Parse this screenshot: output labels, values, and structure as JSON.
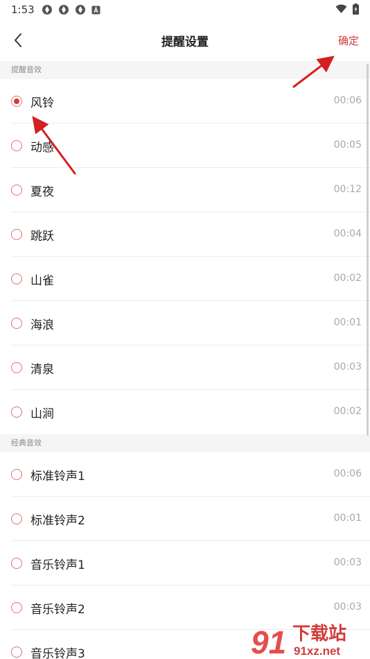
{
  "status_bar": {
    "time": "1:53",
    "left_icons": [
      "app-icon-1",
      "app-icon-2",
      "app-icon-3",
      "notification-a-icon"
    ],
    "right_icons": [
      "wifi-icon",
      "battery-icon"
    ]
  },
  "nav": {
    "title": "提醒设置",
    "confirm_label": "确定",
    "back_icon": "chevron-left-icon"
  },
  "colors": {
    "accent": "#d23b3b",
    "arrow": "#d42020",
    "section_bg": "#f5f5f5"
  },
  "sections": [
    {
      "title": "提醒音效",
      "items": [
        {
          "label": "风铃",
          "duration": "00:06",
          "selected": true
        },
        {
          "label": "动感",
          "duration": "00:05",
          "selected": false
        },
        {
          "label": "夏夜",
          "duration": "00:12",
          "selected": false
        },
        {
          "label": "跳跃",
          "duration": "00:04",
          "selected": false
        },
        {
          "label": "山雀",
          "duration": "00:02",
          "selected": false
        },
        {
          "label": "海浪",
          "duration": "00:01",
          "selected": false
        },
        {
          "label": "清泉",
          "duration": "00:03",
          "selected": false
        },
        {
          "label": "山涧",
          "duration": "00:02",
          "selected": false
        }
      ]
    },
    {
      "title": "经典音效",
      "items": [
        {
          "label": "标准铃声1",
          "duration": "00:06",
          "selected": false
        },
        {
          "label": "标准铃声2",
          "duration": "00:01",
          "selected": false
        },
        {
          "label": "音乐铃声1",
          "duration": "00:03",
          "selected": false
        },
        {
          "label": "音乐铃声2",
          "duration": "00:03",
          "selected": false
        },
        {
          "label": "音乐铃声3",
          "duration": "",
          "selected": false
        }
      ]
    }
  ],
  "watermark": {
    "logo_text": "91",
    "site_text": "下载站",
    "domain_text": "91xz.net"
  }
}
